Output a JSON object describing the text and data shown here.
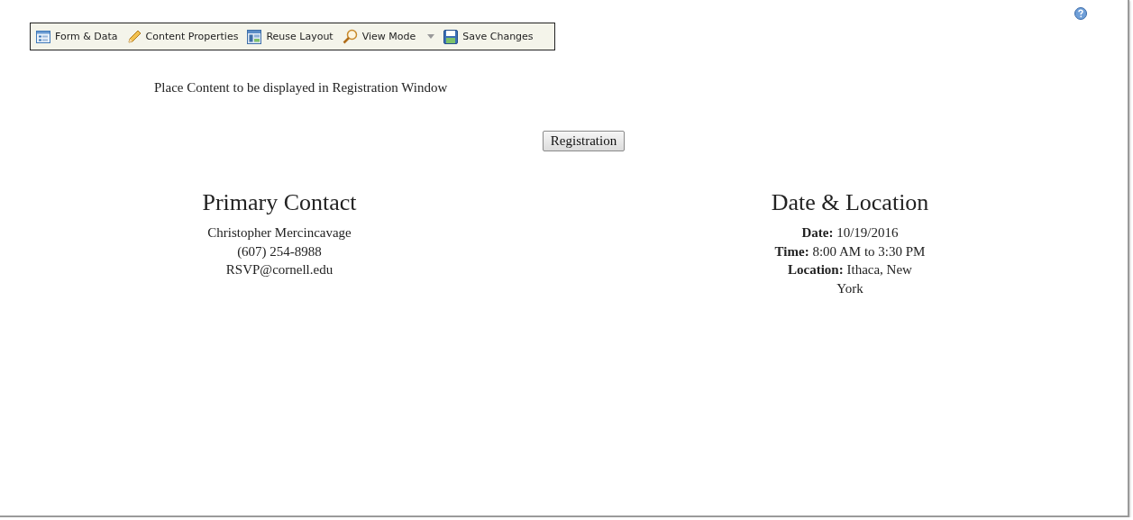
{
  "toolbar": [
    {
      "label": "Form & Data",
      "kind": "form",
      "has_menu": false
    },
    {
      "label": "Content Properties",
      "kind": "pencil",
      "has_menu": false
    },
    {
      "label": "Reuse Layout",
      "kind": "layout",
      "has_menu": false
    },
    {
      "label": "View Mode",
      "kind": "magnifier",
      "has_menu": true
    },
    {
      "label": "Save Changes",
      "kind": "disk",
      "has_menu": false
    }
  ],
  "intro": "Place Content to be displayed in Registration Window",
  "button": "Registration",
  "sections": [
    {
      "title": "Primary Contact",
      "lines": [
        "Christopher Mercincavage",
        "(607) 254-8988",
        "RSVP@cornell.edu"
      ]
    },
    {
      "title": "Date & Location",
      "lines": [
        "**Date:** 10/19/2016",
        "**Time:** 8:00 AM to 3:30 PM",
        "**Location:** Ithaca, New York"
      ]
    }
  ]
}
